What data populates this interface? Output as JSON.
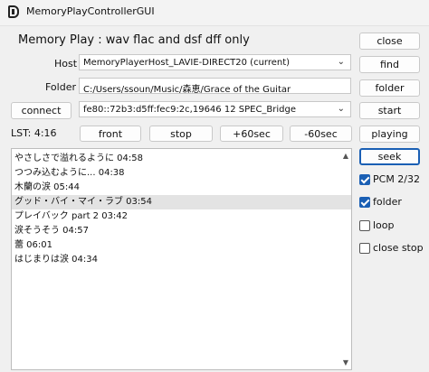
{
  "window": {
    "title": "MemoryPlayControllerGUI"
  },
  "heading": "Memory Play : wav flac and dsf dff only",
  "host": {
    "label": "Host",
    "value": "MemoryPlayerHost_LAVIE-DIRECT20 (current)"
  },
  "folder": {
    "label": "Folder",
    "value": "C:/Users/ssoun/Music/森恵/Grace of the Guitar"
  },
  "address": {
    "value": "fe80::72b3:d5ff:fec9:2c,19646 12 SPEC_Bridge"
  },
  "lst": "LST:  4:16",
  "buttons": {
    "close": "close",
    "find": "find",
    "folder": "folder",
    "start": "start",
    "connect": "connect",
    "front": "front",
    "stop": "stop",
    "plus60": "+60sec",
    "minus60": "-60sec",
    "playing": "playing",
    "seek": "seek"
  },
  "tracks": [
    {
      "label": "やさしさで溢れるように 04:58",
      "selected": false
    },
    {
      "label": "つつみ込むように... 04:38",
      "selected": false
    },
    {
      "label": "木蘭の涙 05:44",
      "selected": false
    },
    {
      "label": "グッド・バイ・マイ・ラブ 03:54",
      "selected": true
    },
    {
      "label": "プレイバック part 2 03:42",
      "selected": false
    },
    {
      "label": "涙そうそう 04:57",
      "selected": false
    },
    {
      "label": "蕾 06:01",
      "selected": false
    },
    {
      "label": "はじまりは涙 04:34",
      "selected": false
    }
  ],
  "options": [
    {
      "key": "pcm",
      "label": "PCM 2/32",
      "checked": true
    },
    {
      "key": "folder",
      "label": "folder",
      "checked": true
    },
    {
      "key": "loop",
      "label": "loop",
      "checked": false
    },
    {
      "key": "closestop",
      "label": "close stop",
      "checked": false
    }
  ],
  "colors": {
    "accent": "#1a5fb4",
    "selected_row": "#e3e3e3"
  }
}
